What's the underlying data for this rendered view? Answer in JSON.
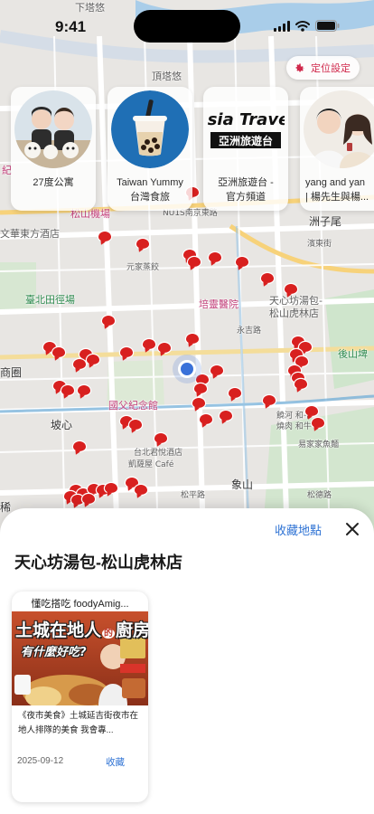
{
  "status_bar": {
    "time": "9:41"
  },
  "map": {
    "labels": [
      {
        "text": "下塔悠",
        "style": ""
      },
      {
        "text": "頂塔悠",
        "style": ""
      },
      {
        "text": "紀",
        "style": "pink"
      },
      {
        "text": "松山機場",
        "style": ""
      },
      {
        "text": "NU1S南京東路",
        "style": "small"
      },
      {
        "text": "洲子尾",
        "style": "dark"
      },
      {
        "text": "文華東方酒店",
        "style": ""
      },
      {
        "text": "濱東街",
        "style": "small"
      },
      {
        "text": "元家蒸餃",
        "style": "small"
      },
      {
        "text": "臺北田徑場",
        "style": "green"
      },
      {
        "text": "培靈醫院",
        "style": "pink"
      },
      {
        "text": "天心坊湯包-",
        "style": ""
      },
      {
        "text": "松山虎林店",
        "style": ""
      },
      {
        "text": "永吉路",
        "style": "small"
      },
      {
        "text": "商圈",
        "style": "dark"
      },
      {
        "text": "後山埤",
        "style": "green"
      },
      {
        "text": "國父紀念館",
        "style": "pink"
      },
      {
        "text": "饒河 和平",
        "style": "small"
      },
      {
        "text": "燒肉 和牛",
        "style": "small"
      },
      {
        "text": "坡心",
        "style": "dark"
      },
      {
        "text": "易家家魚麵",
        "style": "small"
      },
      {
        "text": "台北君悅酒店",
        "style": "small"
      },
      {
        "text": "凱薩屋 Café",
        "style": "small"
      },
      {
        "text": "象山",
        "style": "dark"
      },
      {
        "text": "松平路",
        "style": "small"
      },
      {
        "text": "松德路",
        "style": "small"
      },
      {
        "text": "稀",
        "style": "dark"
      }
    ]
  },
  "location_button": {
    "label": "定位設定"
  },
  "creators": [
    {
      "name": "27度公寓"
    },
    {
      "name": "Taiwan Yummy\n台灣食旅"
    },
    {
      "name": "亞洲旅遊台 -\n官方頻道"
    },
    {
      "name": "yang and yan\n| 楊先生與楊..."
    }
  ],
  "logo_text": {
    "asia_travel_en": "asia Travel",
    "asia_travel_zh": "亞洲旅遊台"
  },
  "sheet": {
    "save_location": "收藏地點",
    "place_title": "天心坊湯包-松山虎林店",
    "video": {
      "channel": "懂吃搭吃 foodyAmig...",
      "thumb_title_1": "土城在地人",
      "thumb_title_small": "的",
      "thumb_title_2": "廚房",
      "thumb_subtitle": "有什麼好吃?",
      "caption": "《夜市美食》土城延吉街夜市在地人排隊的美食 我會專...",
      "date": "2025-09-12",
      "save_label": "收藏"
    }
  }
}
